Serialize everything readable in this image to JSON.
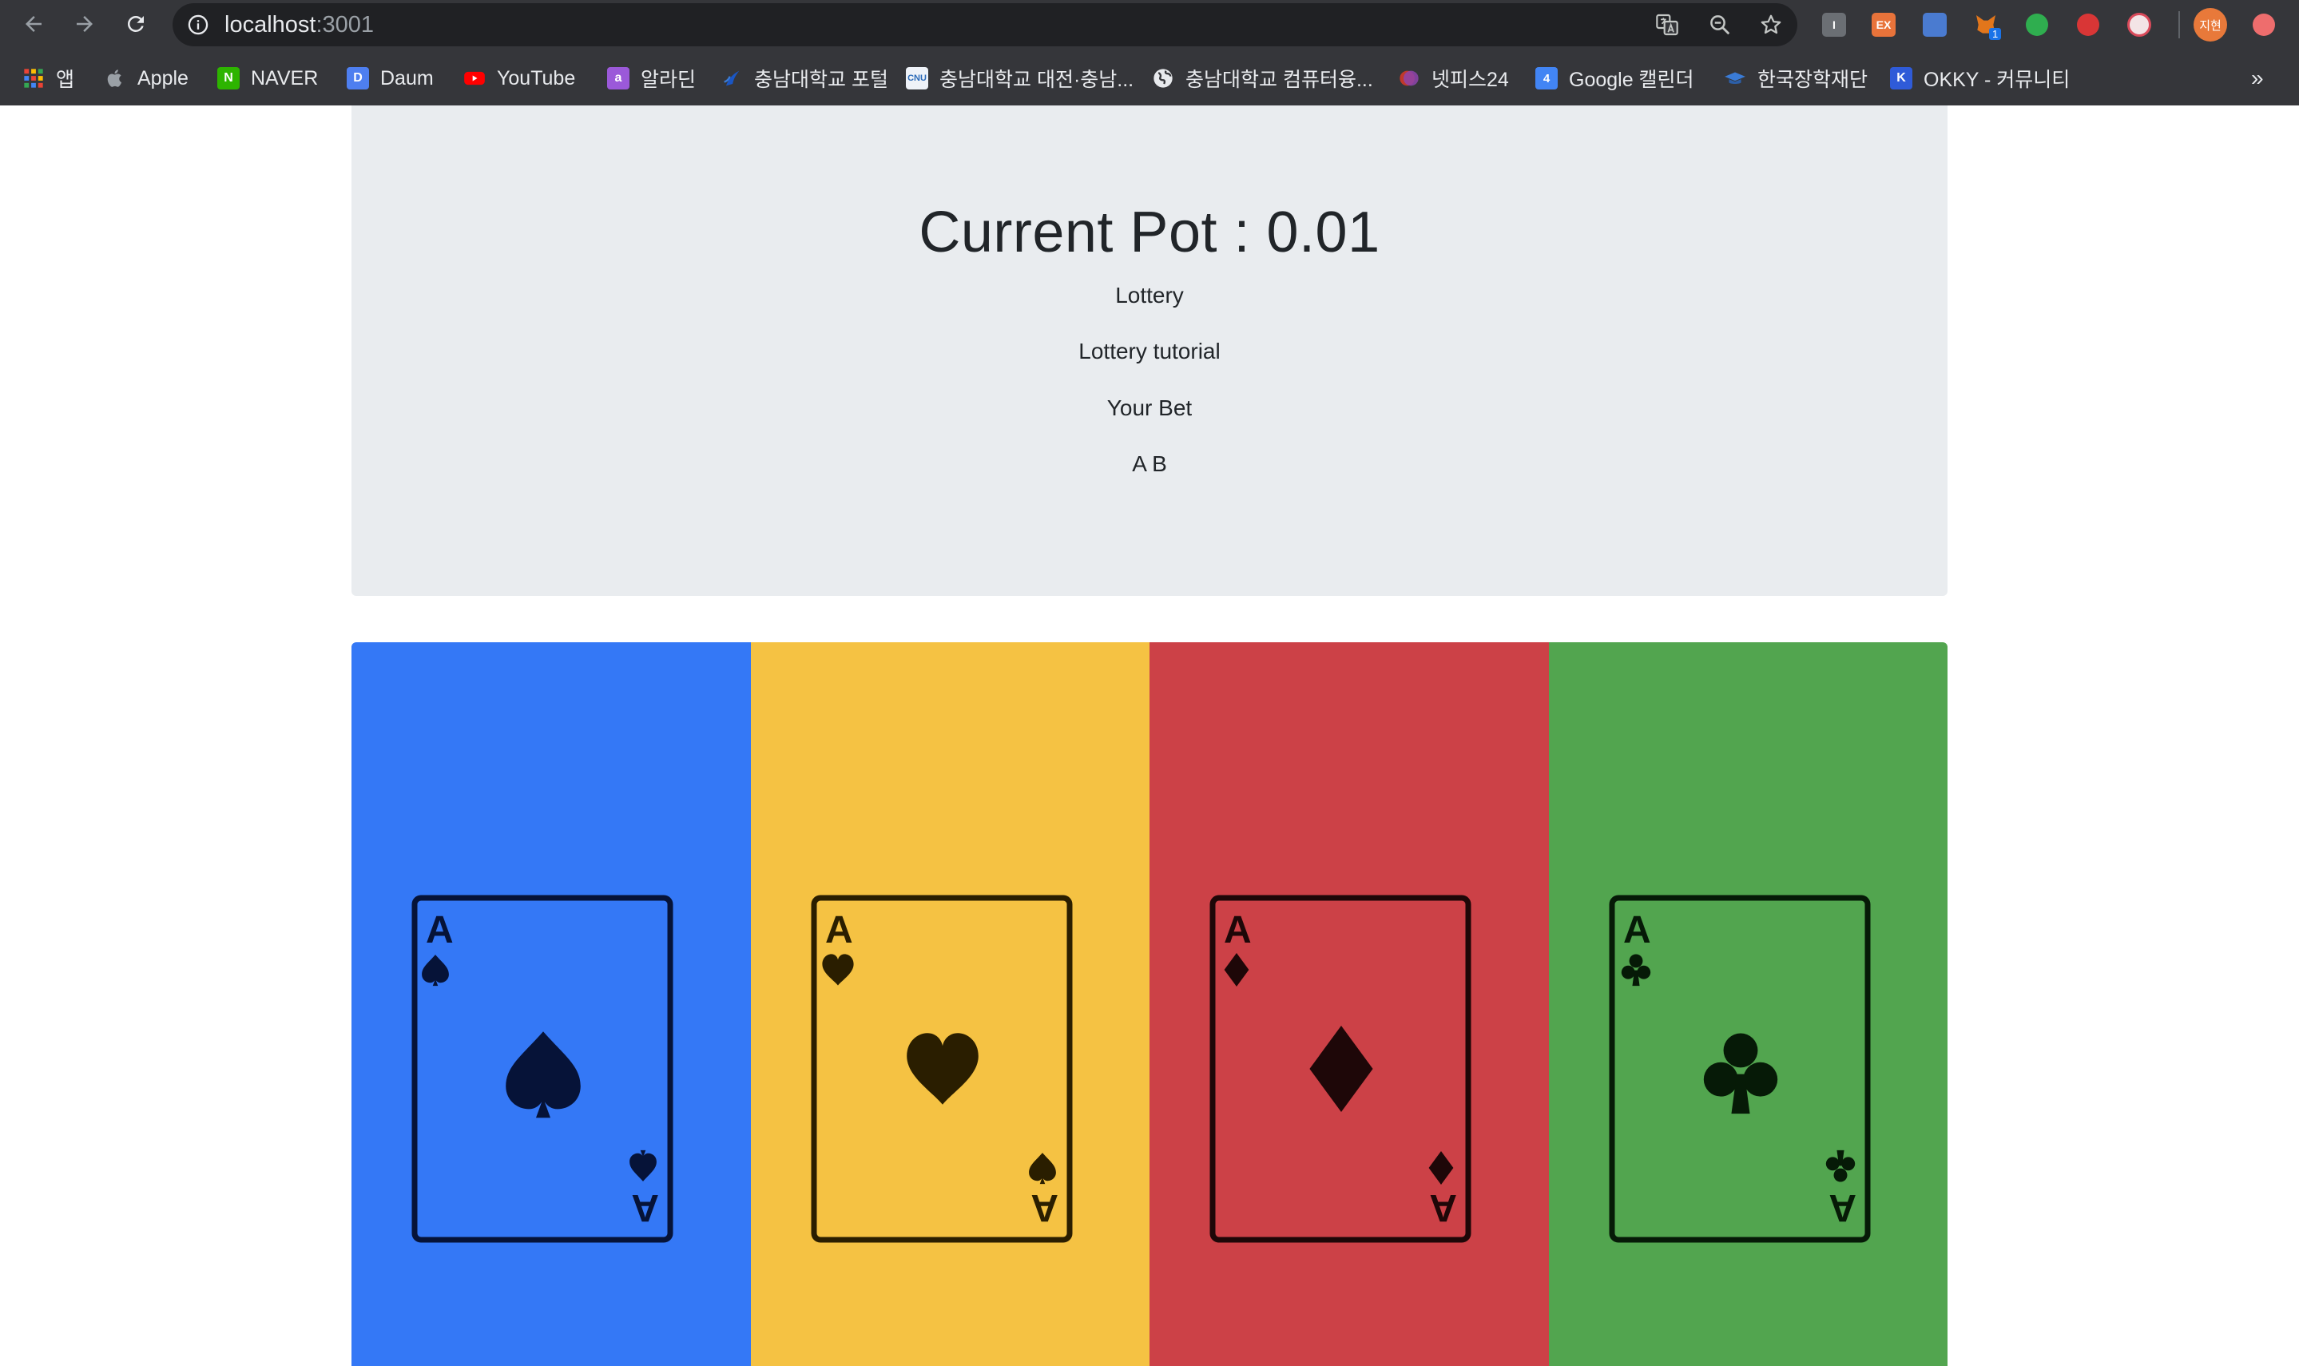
{
  "browser": {
    "url_host": "localhost",
    "url_port": ":3001",
    "avatar_text": "지현",
    "ext_ex_label": "EX",
    "ext_i_label": "I",
    "ext_badge": "1"
  },
  "bookmarks": [
    {
      "label": "앱",
      "icon": "apps-grid-icon"
    },
    {
      "label": "Apple",
      "icon": "apple-icon"
    },
    {
      "label": "NAVER",
      "icon": "naver-icon",
      "fav": "N",
      "color": "#2db400"
    },
    {
      "label": "Daum",
      "icon": "daum-icon",
      "fav": "D",
      "color": "#7d68f0"
    },
    {
      "label": "YouTube",
      "icon": "youtube-icon",
      "color": "#ff0000"
    },
    {
      "label": "알라딘",
      "icon": "aladin-icon",
      "fav": "a",
      "color": "#9b59d9"
    },
    {
      "label": "충남대학교 포털",
      "icon": "cnu-portal-icon",
      "color": "#1a56c4"
    },
    {
      "label": "충남대학교 대전·충남...",
      "icon": "cnu-icon",
      "fav": "CNU",
      "color": "#2a6ab8"
    },
    {
      "label": "충남대학교 컴퓨터융...",
      "icon": "globe-icon"
    },
    {
      "label": "넷피스24",
      "icon": "netpiece-icon",
      "color": "#8e44ad"
    },
    {
      "label": "Google 캘린더",
      "icon": "calendar-icon",
      "fav": "4",
      "color": "#4285f4"
    },
    {
      "label": "한국장학재단",
      "icon": "scholarship-icon",
      "color": "#3a7bd5"
    },
    {
      "label": "OKKY - 커뮤니티",
      "icon": "okky-icon",
      "fav": "K",
      "color": "#2f5bd8"
    }
  ],
  "bookmarks_more": "»",
  "jumbotron": {
    "title": "Current Pot : 0.01",
    "line1": "Lottery",
    "line2": "Lottery tutorial",
    "line3": "Your Bet",
    "line4": "A B"
  },
  "cards": [
    {
      "rank": "A",
      "suit": "spade",
      "bg": "#3478f6",
      "ink": "#061338"
    },
    {
      "rank": "A",
      "suit": "heart",
      "bg": "#f5c243",
      "ink": "#2a1e00"
    },
    {
      "rank": "A",
      "suit": "diamond",
      "bg": "#cc4147",
      "ink": "#1e0708"
    },
    {
      "rank": "A",
      "suit": "club",
      "bg": "#52a54f",
      "ink": "#061a07"
    }
  ]
}
